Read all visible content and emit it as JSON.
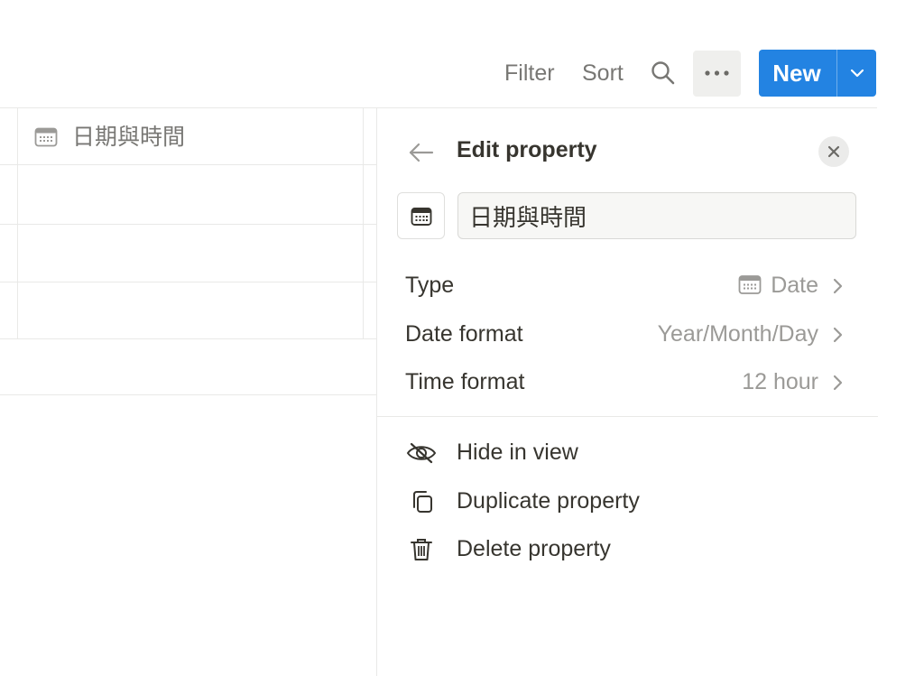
{
  "toolbar": {
    "filter_label": "Filter",
    "sort_label": "Sort",
    "search_icon": "search-icon",
    "more_icon": "more-horizontal-icon",
    "new_label": "New",
    "new_dropdown_icon": "chevron-down-icon"
  },
  "table": {
    "column_header": {
      "icon": "calendar-icon",
      "label": "日期與時間"
    },
    "rows": [
      "",
      "",
      ""
    ]
  },
  "panel": {
    "back_icon": "arrow-left-icon",
    "title": "Edit property",
    "close_icon": "close-icon",
    "property_icon": "calendar-icon",
    "property_name": "日期與時間",
    "settings": [
      {
        "label": "Type",
        "value": "Date",
        "value_icon": "calendar-icon"
      },
      {
        "label": "Date format",
        "value": "Year/Month/Day"
      },
      {
        "label": "Time format",
        "value": "12 hour"
      }
    ],
    "actions": [
      {
        "label": "Hide in view",
        "icon": "eye-off-icon"
      },
      {
        "label": "Duplicate property",
        "icon": "duplicate-icon"
      },
      {
        "label": "Delete property",
        "icon": "trash-icon"
      }
    ]
  },
  "colors": {
    "accent": "#2383e2",
    "text": "#37352f",
    "muted": "#787774",
    "border": "#e9e9e7"
  }
}
